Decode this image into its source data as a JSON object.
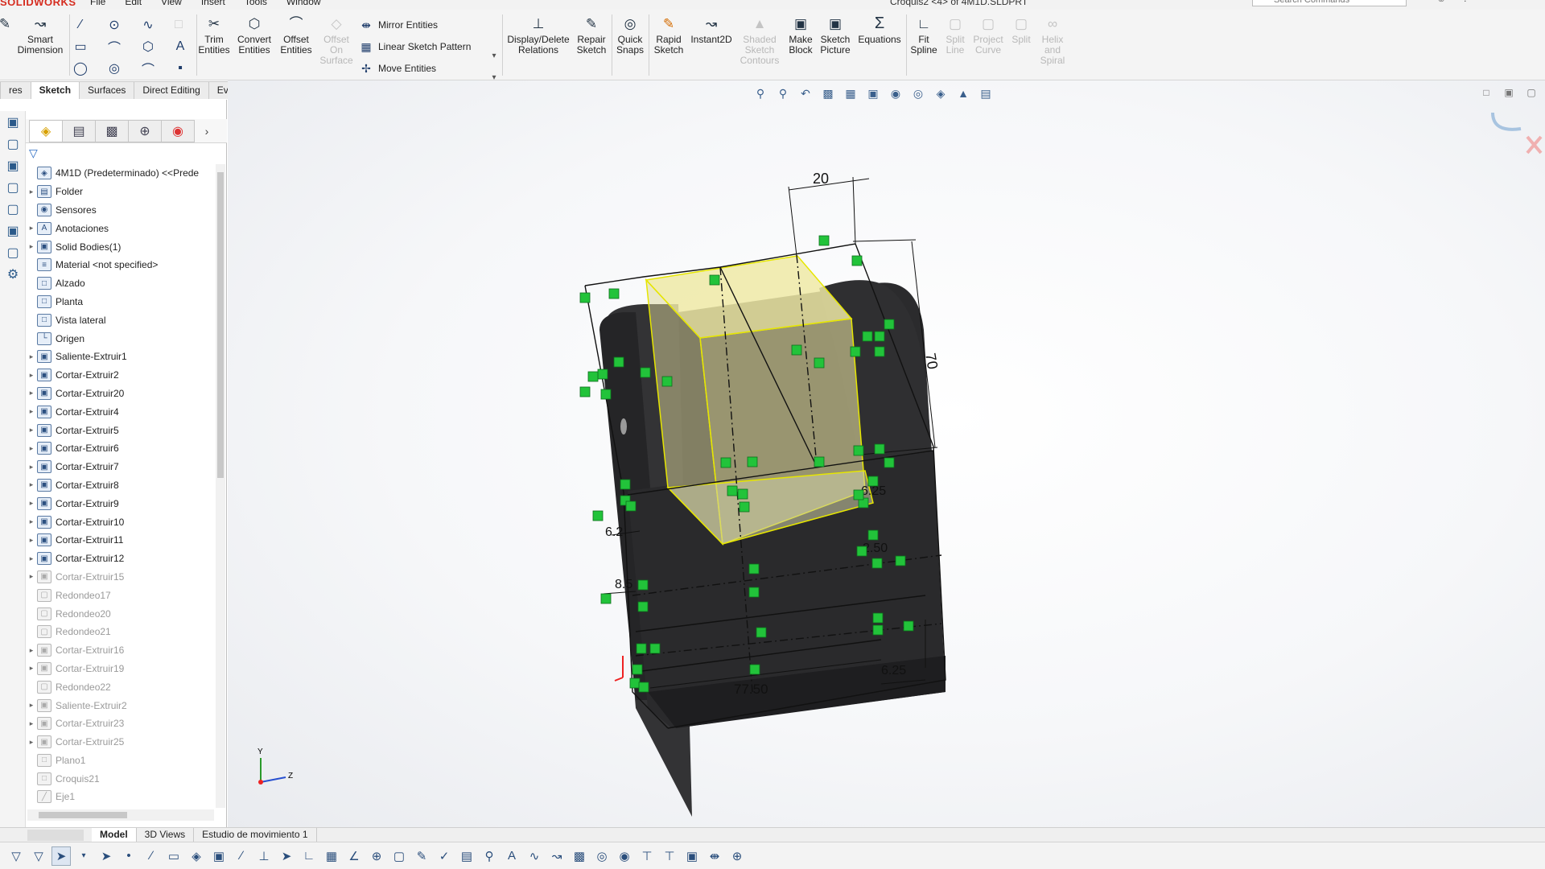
{
  "app": {
    "brand": "SOLIDWORKS",
    "menus": [
      "File",
      "Edit",
      "View",
      "Insert",
      "Tools",
      "Window"
    ],
    "doc_title": "Croquis2 <4> of 4M1D.SLDPRT",
    "search_placeholder": "Search Commands"
  },
  "ribbon": {
    "smart_dimension": "Smart\nDimension",
    "trim": "Trim\nEntities",
    "convert": "Convert\nEntities",
    "offset": "Offset\nEntities",
    "offset_surface": "Offset\nOn\nSurface",
    "mirror": "Mirror Entities",
    "linear_pattern": "Linear Sketch Pattern",
    "move": "Move Entities",
    "display_delete": "Display/Delete\nRelations",
    "repair": "Repair\nSketch",
    "quick_snaps": "Quick\nSnaps",
    "rapid_sketch": "Rapid\nSketch",
    "instant2d": "Instant2D",
    "shaded_contours": "Shaded\nSketch\nContours",
    "make_block": "Make\nBlock",
    "sketch_picture": "Sketch\nPicture",
    "equations": "Equations",
    "fit_spline": "Fit\nSpline",
    "split_line": "Split\nLine",
    "project_curve": "Project\nCurve",
    "split": "Split",
    "helix": "Helix\nand\nSpiral"
  },
  "cm_tabs": [
    "res",
    "Sketch",
    "Surfaces",
    "Direct Editing",
    "Evaluate"
  ],
  "tree": [
    {
      "label": "4M1D (Predeterminado) <<Prede",
      "kind": "part",
      "exp": false,
      "sup": false
    },
    {
      "label": "Folder",
      "kind": "folder",
      "exp": true,
      "sup": false
    },
    {
      "label": "Sensores",
      "kind": "sensor",
      "exp": false,
      "sup": false
    },
    {
      "label": "Anotaciones",
      "kind": "annot",
      "exp": true,
      "sup": false
    },
    {
      "label": "Solid Bodies(1)",
      "kind": "body",
      "exp": true,
      "sup": false
    },
    {
      "label": "Material <not specified>",
      "kind": "material",
      "exp": false,
      "sup": false
    },
    {
      "label": "Alzado",
      "kind": "plane",
      "exp": false,
      "sup": false
    },
    {
      "label": "Planta",
      "kind": "plane",
      "exp": false,
      "sup": false
    },
    {
      "label": "Vista lateral",
      "kind": "plane",
      "exp": false,
      "sup": false
    },
    {
      "label": "Origen",
      "kind": "origin",
      "exp": false,
      "sup": false
    },
    {
      "label": "Saliente-Extruir1",
      "kind": "feat",
      "exp": true,
      "sup": false
    },
    {
      "label": "Cortar-Extruir2",
      "kind": "feat",
      "exp": true,
      "sup": false
    },
    {
      "label": "Cortar-Extruir20",
      "kind": "feat",
      "exp": true,
      "sup": false
    },
    {
      "label": "Cortar-Extruir4",
      "kind": "feat",
      "exp": true,
      "sup": false
    },
    {
      "label": "Cortar-Extruir5",
      "kind": "feat",
      "exp": true,
      "sup": false
    },
    {
      "label": "Cortar-Extruir6",
      "kind": "feat",
      "exp": true,
      "sup": false
    },
    {
      "label": "Cortar-Extruir7",
      "kind": "feat",
      "exp": true,
      "sup": false
    },
    {
      "label": "Cortar-Extruir8",
      "kind": "feat",
      "exp": true,
      "sup": false
    },
    {
      "label": "Cortar-Extruir9",
      "kind": "feat",
      "exp": true,
      "sup": false
    },
    {
      "label": "Cortar-Extruir10",
      "kind": "feat",
      "exp": true,
      "sup": false
    },
    {
      "label": "Cortar-Extruir11",
      "kind": "feat",
      "exp": true,
      "sup": false
    },
    {
      "label": "Cortar-Extruir12",
      "kind": "feat",
      "exp": true,
      "sup": false
    },
    {
      "label": "Cortar-Extruir15",
      "kind": "feat",
      "exp": true,
      "sup": true
    },
    {
      "label": "Redondeo17",
      "kind": "fillet",
      "exp": false,
      "sup": true
    },
    {
      "label": "Redondeo20",
      "kind": "fillet",
      "exp": false,
      "sup": true
    },
    {
      "label": "Redondeo21",
      "kind": "fillet",
      "exp": false,
      "sup": true
    },
    {
      "label": "Cortar-Extruir16",
      "kind": "feat",
      "exp": true,
      "sup": true
    },
    {
      "label": "Cortar-Extruir19",
      "kind": "feat",
      "exp": true,
      "sup": true
    },
    {
      "label": "Redondeo22",
      "kind": "fillet",
      "exp": false,
      "sup": true
    },
    {
      "label": "Saliente-Extruir2",
      "kind": "feat",
      "exp": true,
      "sup": true
    },
    {
      "label": "Cortar-Extruir23",
      "kind": "feat",
      "exp": true,
      "sup": true
    },
    {
      "label": "Cortar-Extruir25",
      "kind": "feat",
      "exp": true,
      "sup": true
    },
    {
      "label": "Plano1",
      "kind": "plane",
      "exp": false,
      "sup": true
    },
    {
      "label": "Croquis21",
      "kind": "sketch",
      "exp": false,
      "sup": true
    },
    {
      "label": "Eje1",
      "kind": "axis",
      "exp": false,
      "sup": true
    }
  ],
  "bottom_tabs": [
    "Model",
    "3D Views",
    "Estudio de movimiento 1"
  ],
  "dimensions": {
    "top_width": "20",
    "height": "70",
    "d_625_right": "6.25",
    "d_250": "2.50",
    "d_62": "6.2",
    "d_85": "8.5",
    "bottom_width": "77.50",
    "d_625_bottom": "6.25"
  },
  "triad": {
    "y": "Y",
    "z": "Z"
  },
  "colors": {
    "body": "#2b2b2d",
    "sketch_fill": "#e8e3a0",
    "sketch_edge": "#e6e600",
    "relation": "#22c33a",
    "dimension": "#111111"
  }
}
